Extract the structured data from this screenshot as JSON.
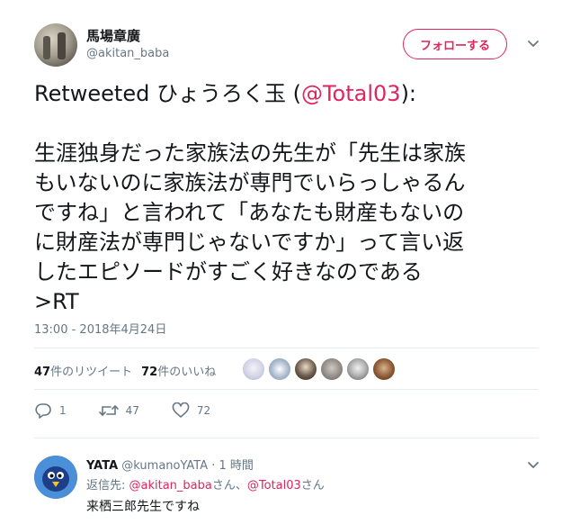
{
  "tweet": {
    "author_name": "馬場章廣",
    "author_handle": "@akitan_baba",
    "follow_label": "フォローする",
    "text_prefix": "Retweeted ひょうろく玉 (",
    "text_mention": "@Total03",
    "text_suffix": "):",
    "body_lines": [
      "生涯独身だった家族法の先生が「先生は家族",
      "もいないのに家族法が専門でいらっしゃるん",
      "ですね」と言われて「あなたも財産もないの",
      "に財産法が専門じゃないですか」って言い返",
      "したエピソードがすごく好きなのである",
      ">RT"
    ],
    "timestamp": "13:00 - 2018年4月24日"
  },
  "stats": {
    "retweets_count": "47",
    "retweets_label": "件のリツイート",
    "likes_count": "72",
    "likes_label": "件のいいね"
  },
  "actions": {
    "reply_count": "1",
    "retweet_count": "47",
    "like_count": "72"
  },
  "reply": {
    "name": "YATA",
    "handle": "@kumanoYATA",
    "time": "· 1 時間",
    "reply_to_prefix": "返信先: ",
    "mention1": "@akitan_baba",
    "sep": "さん、",
    "mention2": "@Total03",
    "suffix": "さん",
    "text": "来栖三郎先生ですね"
  },
  "colors": {
    "accent": "#e0245e",
    "secondary_text": "#657786",
    "primary_text": "#14171a",
    "divider": "#e6ecf0"
  }
}
